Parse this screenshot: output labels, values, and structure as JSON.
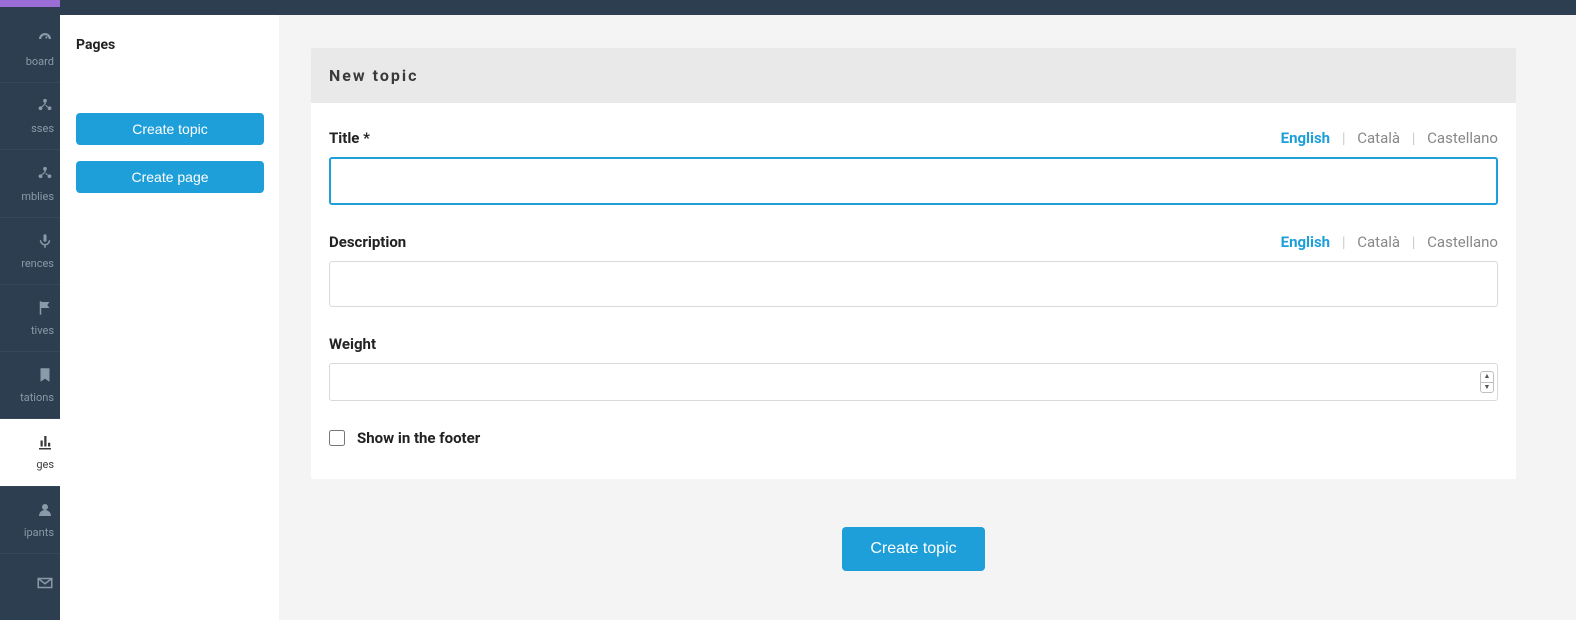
{
  "nav": {
    "items": [
      {
        "label": "board",
        "icon": "gauge"
      },
      {
        "label": "sses",
        "icon": "tree"
      },
      {
        "label": "mblies",
        "icon": "tree"
      },
      {
        "label": "rences",
        "icon": "mic"
      },
      {
        "label": "tives",
        "icon": "flag"
      },
      {
        "label": "tations",
        "icon": "bookmark"
      },
      {
        "label": "ges",
        "icon": "chart"
      },
      {
        "label": "ipants",
        "icon": "user"
      },
      {
        "label": "",
        "icon": "mail"
      }
    ],
    "active_index": 6
  },
  "sidepanel": {
    "title": "Pages",
    "create_topic": "Create topic",
    "create_page": "Create page"
  },
  "form": {
    "heading": "New topic",
    "title_label": "Title",
    "required_mark": "*",
    "description_label": "Description",
    "weight_label": "Weight",
    "footer_label": "Show in the footer",
    "submit": "Create topic",
    "title_value": "",
    "description_value": "",
    "weight_value": "",
    "footer_checked": false
  },
  "langs": {
    "active": "English",
    "others": [
      "Català",
      "Castellano"
    ]
  }
}
